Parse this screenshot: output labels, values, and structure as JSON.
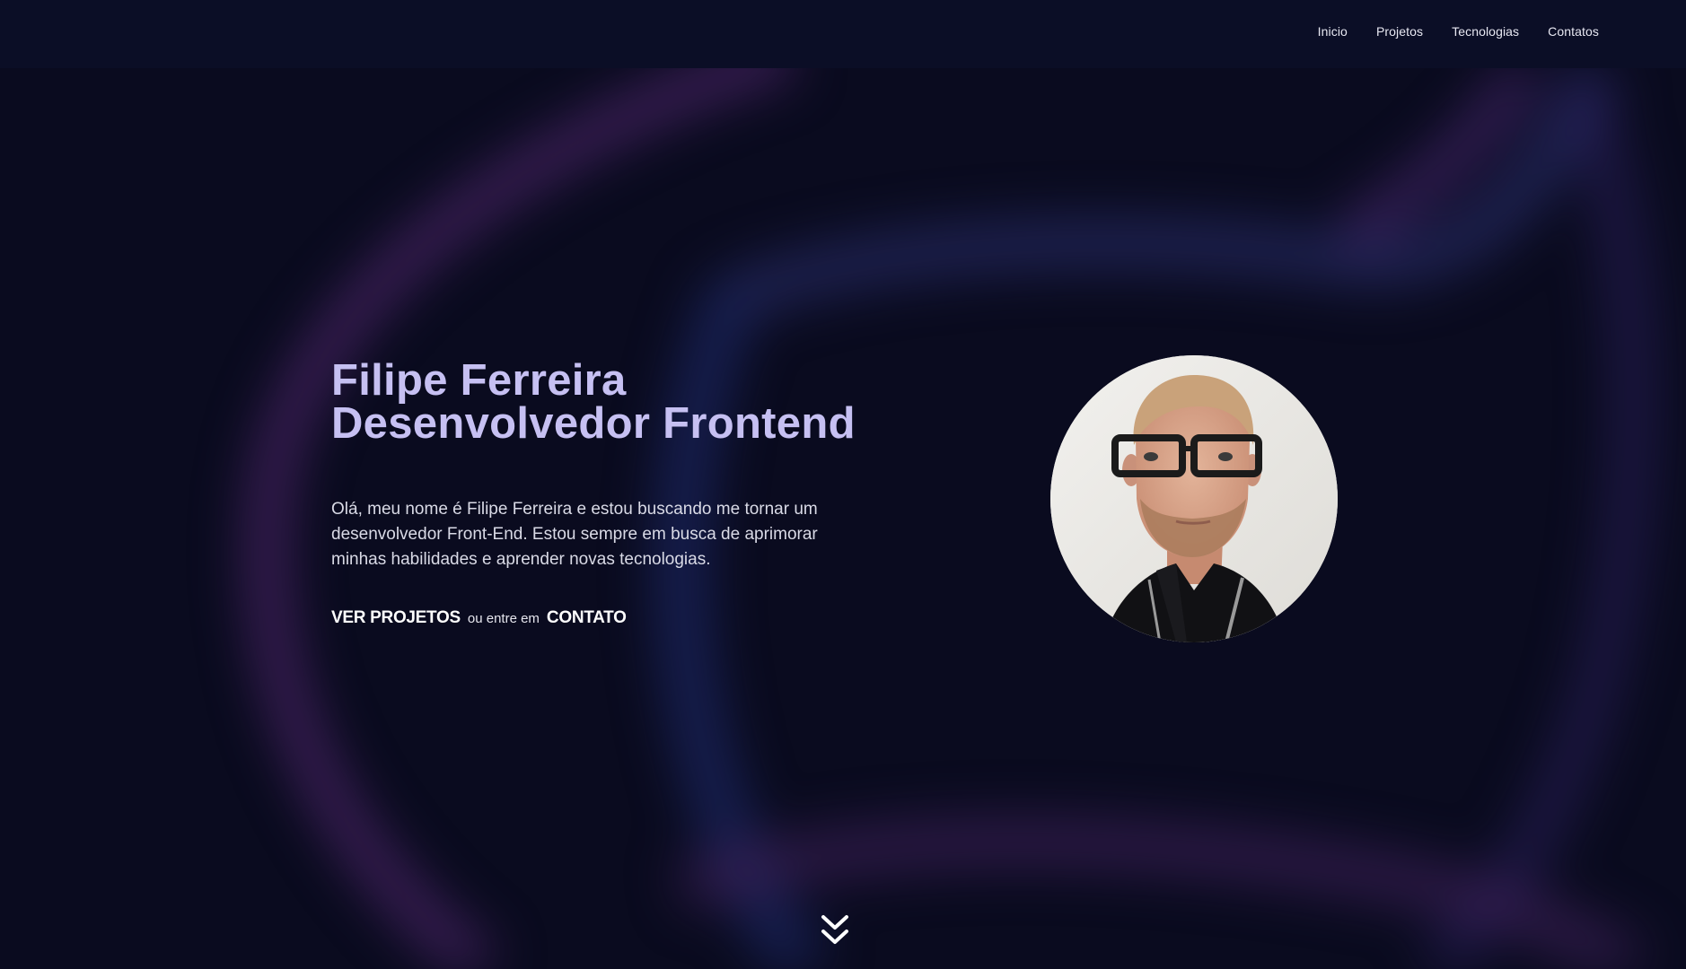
{
  "nav": {
    "items": [
      {
        "label": "Inicio"
      },
      {
        "label": "Projetos"
      },
      {
        "label": "Tecnologias"
      },
      {
        "label": "Contatos"
      }
    ]
  },
  "hero": {
    "name": "Filipe Ferreira",
    "role": "Desenvolvedor Frontend",
    "description": "Olá, meu nome é Filipe Ferreira e estou buscando me tornar um desenvolvedor Front-End. Estou sempre em busca de aprimorar minhas habilidades e aprender novas tecnologias.",
    "cta_projects": "VER PROJETOS",
    "cta_or": "ou entre em",
    "cta_contact": "CONTATO"
  },
  "icons": {
    "scroll": "double-chevron-down-icon"
  },
  "colors": {
    "background": "#0a0b1f",
    "navbar": "#0b0e26",
    "title": "#c6c0f2",
    "text": "#d9dae6",
    "glow_purple": "#5a2a7a",
    "glow_blue": "#1f2a6e"
  }
}
